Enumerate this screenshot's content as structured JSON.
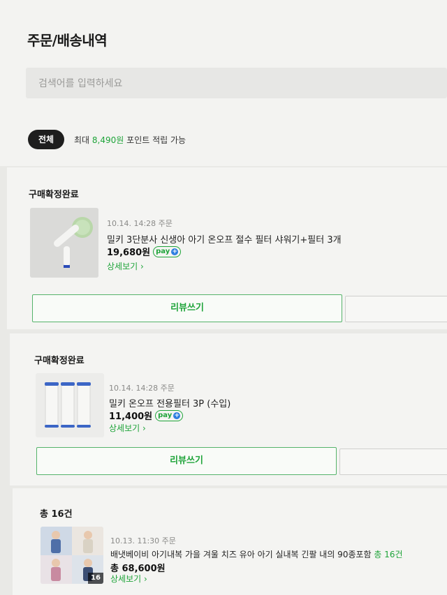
{
  "header": {
    "title": "주문/배송내역",
    "search_placeholder": "검색어를 입력하세요",
    "filter_label": "전체",
    "point_prefix": "최대",
    "point_amount": "8,490원",
    "point_suffix": "포인트 적립 가능"
  },
  "orders": [
    {
      "status": "구매확정완료",
      "date": "10.14. 14:28 주문",
      "name": "밀키 3단분사 신생아 아기 온오프 절수 필터 샤워기+필터 3개",
      "price": "19,680원",
      "pay_badge": "pay",
      "detail_label": "상세보기",
      "review_label": "리뷰쓰기"
    },
    {
      "status": "구매확정완료",
      "date": "10.14. 14:28 주문",
      "name": "밀키 온오프 전용필터 3P (수입)",
      "price": "11,400원",
      "pay_badge": "pay",
      "detail_label": "상세보기",
      "review_label": "리뷰쓰기"
    }
  ],
  "bundle": {
    "title": "총 16건",
    "date": "10.13. 11:30 주문",
    "name": "배냇베이비 아기내복 가을 겨울 치즈 유아 아기 실내복 긴팔 내의 90종포함",
    "name_count": "총 16건",
    "total_label": "총 68,600원",
    "thumb_count": "16",
    "detail_label": "상세보기"
  },
  "colors": {
    "accent": "#1fa43a",
    "chip_bg": "#1e1e1e",
    "npay_plus": "#2d7ee0"
  }
}
